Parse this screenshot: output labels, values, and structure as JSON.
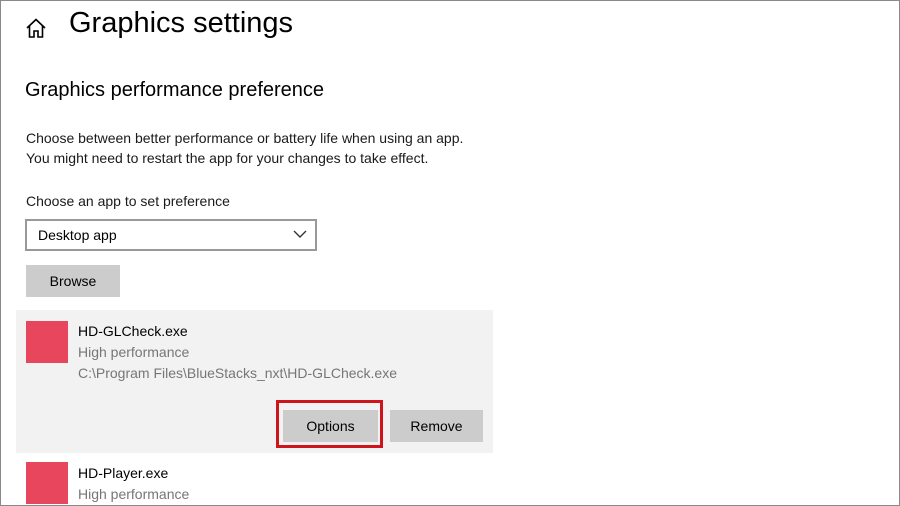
{
  "header": {
    "home_icon": "home-icon",
    "title": "Graphics settings"
  },
  "section": {
    "title": "Graphics performance preference",
    "description_line1": "Choose between better performance or battery life when using an app.",
    "description_line2": "You might need to restart the app for your changes to take effect."
  },
  "app_picker": {
    "label": "Choose an app to set preference",
    "selected": "Desktop app",
    "browse_label": "Browse"
  },
  "apps": [
    {
      "name": "HD-GLCheck.exe",
      "preference": "High performance",
      "path": "C:\\Program Files\\BlueStacks_nxt\\HD-GLCheck.exe",
      "options_label": "Options",
      "remove_label": "Remove",
      "icon_color": "#e8465c"
    },
    {
      "name": "HD-Player.exe",
      "preference": "High performance",
      "icon_color": "#e8465c"
    }
  ],
  "colors": {
    "highlight": "#d0141b",
    "card_background": "#f2f2f2",
    "button_background": "#cccccc"
  }
}
